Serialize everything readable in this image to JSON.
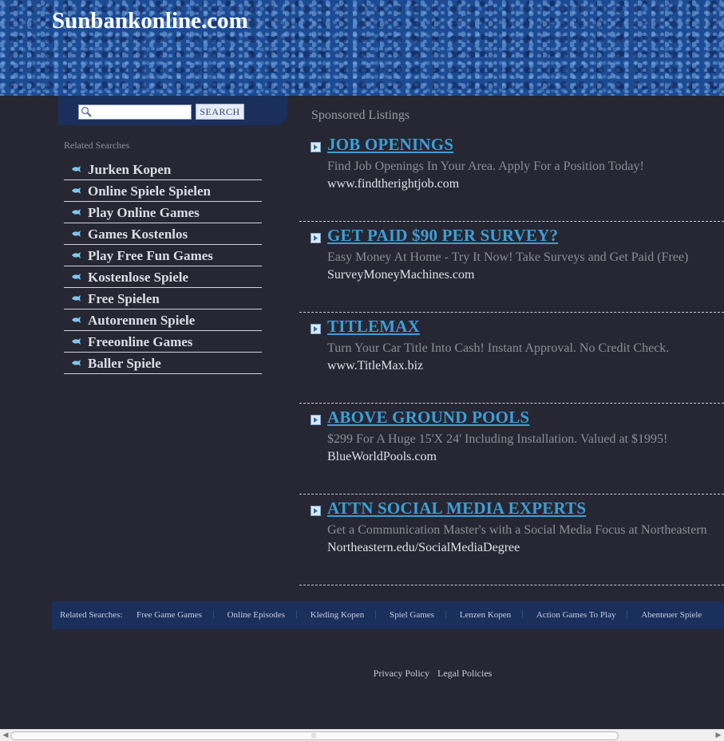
{
  "header": {
    "title": "Sunbankonline.com"
  },
  "search": {
    "placeholder": "",
    "value": "",
    "button_label": "SEARCH"
  },
  "sidebar": {
    "heading": "Related Searches",
    "items": [
      {
        "label": "Jurken Kopen"
      },
      {
        "label": "Online Spiele Spielen"
      },
      {
        "label": "Play Online Games"
      },
      {
        "label": "Games Kostenlos"
      },
      {
        "label": "Play Free Fun Games"
      },
      {
        "label": "Kostenlose Spiele"
      },
      {
        "label": "Free Spielen"
      },
      {
        "label": "Autorennen Spiele"
      },
      {
        "label": "Freeonline Games"
      },
      {
        "label": "Baller Spiele"
      }
    ]
  },
  "main": {
    "heading": "Sponsored Listings",
    "ads": [
      {
        "title": "JOB OPENINGS",
        "description": "Find Job Openings In Your Area. Apply For a Position Today!",
        "url": "www.findtherightjob.com"
      },
      {
        "title": "GET PAID $90 PER SURVEY?",
        "description": "Easy Money At Home - Try It Now! Take Surveys and Get Paid (Free)",
        "url": "SurveyMoneyMachines.com"
      },
      {
        "title": "TITLEMAX",
        "description": "Turn Your Car Title Into Cash! Instant Approval. No Credit Check.",
        "url": "www.TitleMax.biz"
      },
      {
        "title": "ABOVE GROUND POOLS",
        "description": "$299 For A Huge 15'X 24' Including Installation. Valued at $1995!",
        "url": "BlueWorldPools.com"
      },
      {
        "title": "ATTN SOCIAL MEDIA EXPERTS",
        "description": "Get a Communication Master's with a Social Media Focus at Northeastern",
        "url": "Northeastern.edu/SocialMediaDegree"
      }
    ]
  },
  "footer": {
    "label": "Related Searches:",
    "links": [
      {
        "label": "Free Game Games"
      },
      {
        "label": "Online Episodes"
      },
      {
        "label": "Kleding Kopen"
      },
      {
        "label": "Spiel Games"
      },
      {
        "label": "Lenzen Kopen"
      },
      {
        "label": "Action Games To Play"
      },
      {
        "label": "Abenteuer Spiele"
      }
    ],
    "legal": {
      "privacy": "Privacy Policy",
      "legal": "Legal Policies"
    }
  },
  "colors": {
    "background": "#262733",
    "header_blue": "#1c4b93",
    "link_blue": "#3d9fd6",
    "bar_navy": "#1b2f5c"
  },
  "icons": {
    "search": "magnifier-icon",
    "sidebar_bullet": "fish-bullet-icon",
    "ad_arrow": "arrow-box-icon"
  }
}
